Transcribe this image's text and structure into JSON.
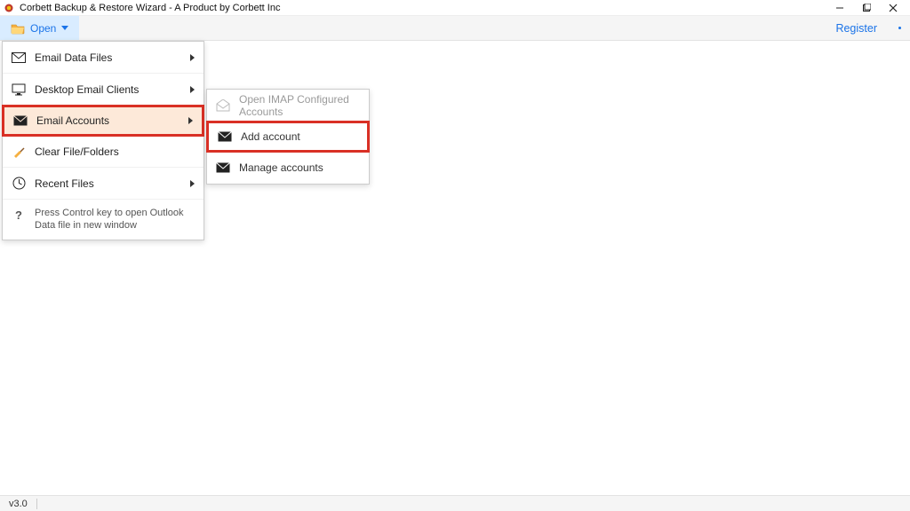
{
  "window": {
    "title": "Corbett Backup & Restore Wizard - A Product by Corbett Inc"
  },
  "toolbar": {
    "open_label": "Open",
    "register_label": "Register"
  },
  "menu": {
    "items": [
      {
        "label": "Email Data Files"
      },
      {
        "label": "Desktop Email Clients"
      },
      {
        "label": "Email Accounts"
      },
      {
        "label": "Clear File/Folders"
      },
      {
        "label": "Recent Files"
      }
    ],
    "hint": "Press Control key to open Outlook Data file in new window"
  },
  "submenu": {
    "items": [
      {
        "label": "Open IMAP Configured Accounts"
      },
      {
        "label": "Add account"
      },
      {
        "label": "Manage accounts"
      }
    ]
  },
  "statusbar": {
    "version": "v3.0"
  },
  "colors": {
    "accent": "#1a73e8",
    "highlight_border": "#d93025",
    "highlight_fill": "#fde9d9"
  }
}
